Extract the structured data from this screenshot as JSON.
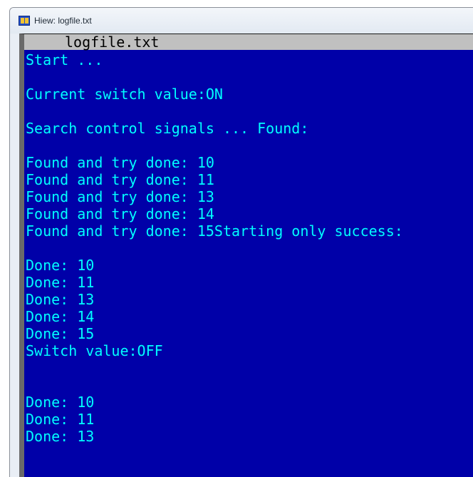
{
  "window": {
    "title": "Hiew: logfile.txt"
  },
  "editor": {
    "filename": "logfile.txt",
    "lines": [
      "Start ...",
      "",
      "Current switch value:ON",
      "",
      "Search control signals ... Found:",
      "",
      "Found and try done: 10",
      "Found and try done: 11",
      "Found and try done: 13",
      "Found and try done: 14",
      "Found and try done: 15Starting only success:",
      "",
      "Done: 10",
      "Done: 11",
      "Done: 13",
      "Done: 14",
      "Done: 15",
      "Switch value:OFF",
      "",
      "",
      "Done: 10",
      "Done: 11",
      "Done: 13"
    ]
  },
  "colors": {
    "background": "#0000a8",
    "text": "#00ffff",
    "header_background": "#c0c0c0",
    "scroll_indicator": "#1aa51a"
  },
  "icons": {
    "app": "hiew-app-icon",
    "scroll_up": "arrow-up-icon"
  }
}
